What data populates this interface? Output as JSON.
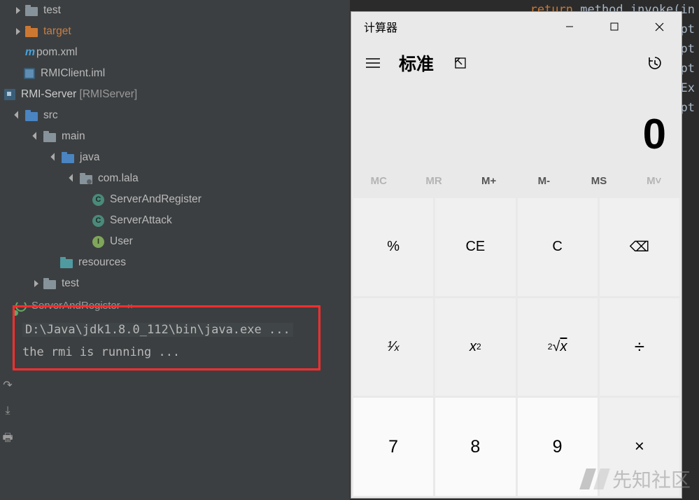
{
  "tree": {
    "test1": "test",
    "target": "target",
    "pom": "pom.xml",
    "iml": "RMIClient.iml",
    "server": "RMI-Server",
    "server_label": "[RMIServer]",
    "src": "src",
    "main": "main",
    "java": "java",
    "pkg": "com.lala",
    "cls1": "ServerAndRegister",
    "cls2": "ServerAttack",
    "cls3": "User",
    "resources": "resources",
    "test2": "test"
  },
  "editor": {
    "line0_kw": "return",
    "line0_rest": " method.invoke(in",
    "line1": "ept",
    "line2": "ept",
    "line3": "ept",
    "line4": "tEx",
    "line5": "ept"
  },
  "console": {
    "tab": "ServerAndRegister",
    "cmd": "D:\\Java\\jdk1.8.0_112\\bin\\java.exe ...",
    "out": "the rmi is running ..."
  },
  "calc": {
    "title": "计算器",
    "mode": "标准",
    "display": "0",
    "mem": {
      "mc": "MC",
      "mr": "MR",
      "mplus": "M+",
      "mminus": "M-",
      "ms": "MS",
      "mlist": "M˅"
    },
    "keys": {
      "percent": "%",
      "ce": "CE",
      "c": "C",
      "back": "⌫",
      "inv": "¹⁄ₓ",
      "sq": "x²",
      "sqrt": "²√x",
      "div": "÷",
      "k7": "7",
      "k8": "8",
      "k9": "9",
      "mul": "×"
    }
  },
  "watermark": "先知社区"
}
